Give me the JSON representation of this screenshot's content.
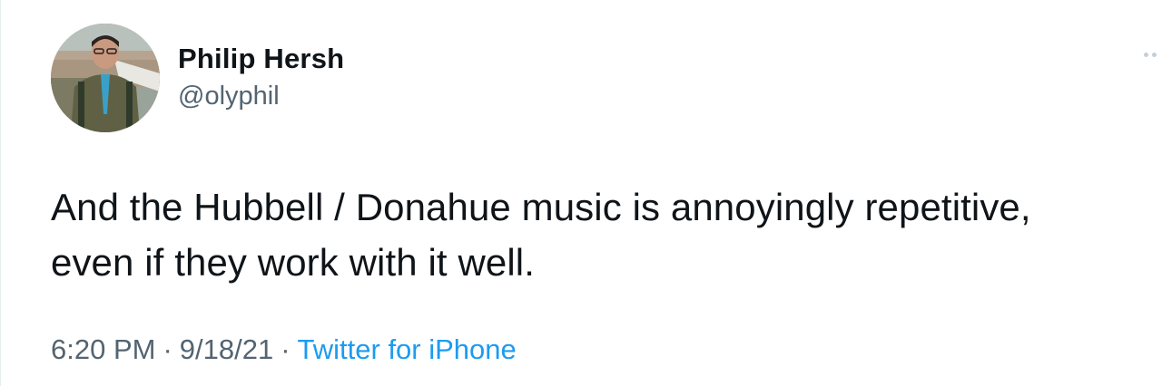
{
  "author": {
    "name": "Philip Hersh",
    "handle": "@olyphil"
  },
  "tweet": {
    "text_line1": "And the Hubbell / Donahue music is annoyingly repetitive,",
    "text_line2": "even if they work with it well.",
    "time": "6:20 PM",
    "date": "9/18/21",
    "separator": "·",
    "source": "Twitter for iPhone"
  },
  "icons": {
    "more": "more-options-icon",
    "avatar": "profile-photo"
  },
  "colors": {
    "text": "#0f1419",
    "secondary": "#536471",
    "link": "#1d9bf0"
  }
}
